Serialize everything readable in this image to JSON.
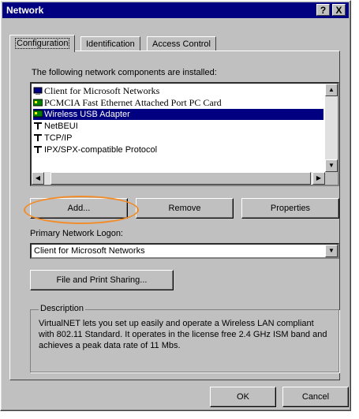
{
  "window": {
    "title": "Network",
    "help_label": "?",
    "close_label": "X"
  },
  "tabs": [
    {
      "label": "Configuration"
    },
    {
      "label": "Identification"
    },
    {
      "label": "Access Control"
    }
  ],
  "components": {
    "heading": "The following network components are installed:",
    "items": [
      {
        "label": "Client for Microsoft Networks",
        "icon": "client-icon",
        "selected": false
      },
      {
        "label": "PCMCIA Fast Ethernet Attached Port PC Card",
        "icon": "adapter-icon",
        "selected": false
      },
      {
        "label": "Wireless USB Adapter",
        "icon": "adapter-icon",
        "selected": true
      },
      {
        "label": "NetBEUI",
        "icon": "protocol-icon",
        "selected": false
      },
      {
        "label": "TCP/IP",
        "icon": "protocol-icon",
        "selected": false
      },
      {
        "label": "IPX/SPX-compatible Protocol",
        "icon": "protocol-icon",
        "selected": false
      }
    ]
  },
  "buttons": {
    "add": "Add...",
    "remove": "Remove",
    "properties": "Properties"
  },
  "logon": {
    "label": "Primary Network Logon:",
    "value": "Client for Microsoft Networks"
  },
  "file_sharing": {
    "label": "File and Print Sharing..."
  },
  "description": {
    "legend": "Description",
    "text": "VirtualNET lets you set up easily and operate a Wireless LAN compliant with 802.11 Standard. It operates in the license free 2.4 GHz ISM band and achieves a peak data rate of 11 Mbs."
  },
  "footer": {
    "ok": "OK",
    "cancel": "Cancel"
  },
  "colors": {
    "accent": "#000080",
    "highlight_ellipse": "#f28c28",
    "face": "#c0c0c0"
  }
}
